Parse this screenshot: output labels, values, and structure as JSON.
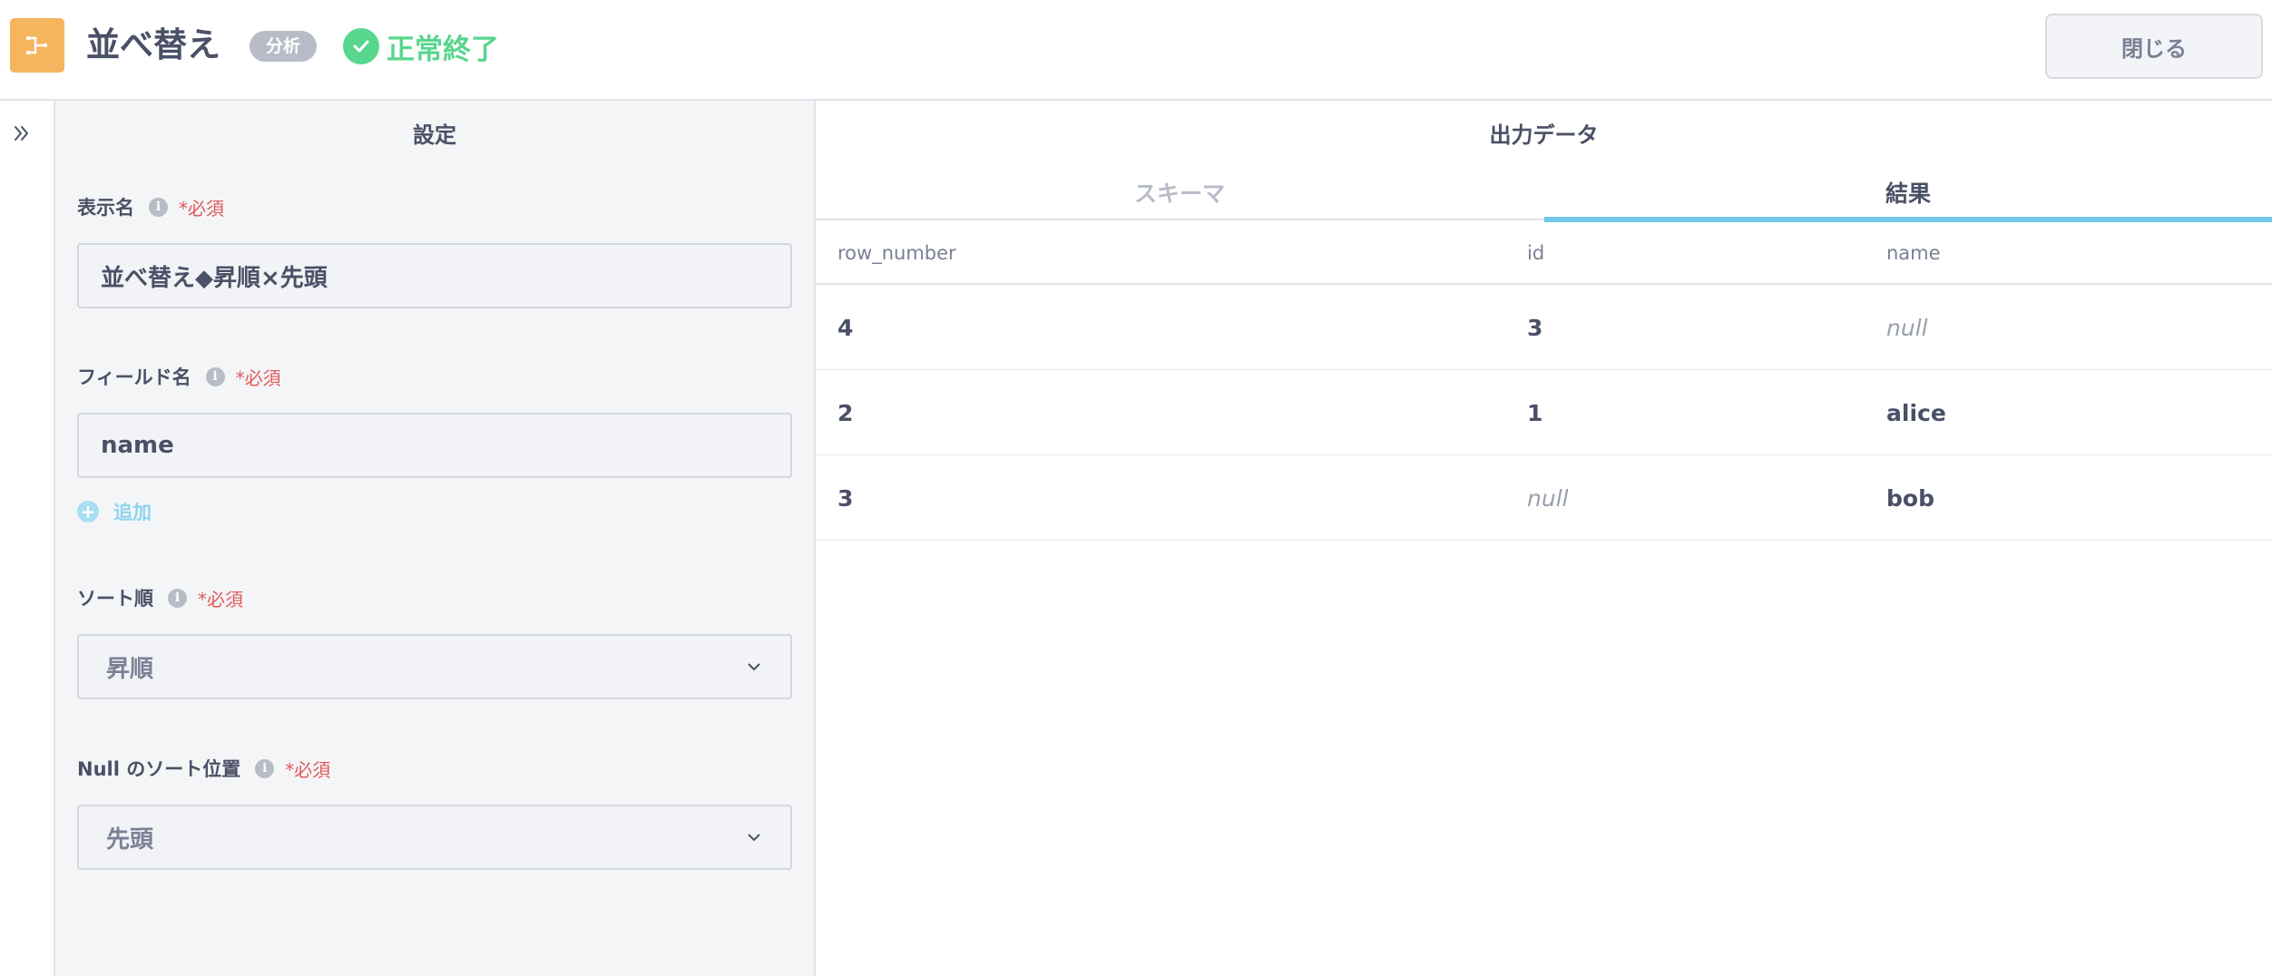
{
  "header": {
    "title": "並べ替え",
    "tag": "分析",
    "status": "正常終了",
    "close_label": "閉じる"
  },
  "settings": {
    "panel_title": "設定",
    "required_mark": "*必須",
    "display_name": {
      "label": "表示名",
      "value": "並べ替え◆昇順×先頭"
    },
    "field_name": {
      "label": "フィールド名",
      "value": "name"
    },
    "add_label": "追加",
    "sort_order": {
      "label": "ソート順",
      "value": "昇順"
    },
    "null_position": {
      "label": "Null のソート位置",
      "value": "先頭"
    }
  },
  "output": {
    "title": "出力データ",
    "tabs": {
      "schema": "スキーマ",
      "result": "結果"
    },
    "columns": [
      "row_number",
      "id",
      "name"
    ],
    "rows": [
      [
        "4",
        "3",
        "null"
      ],
      [
        "2",
        "1",
        "alice"
      ],
      [
        "3",
        "null",
        "bob"
      ]
    ]
  },
  "colors": {
    "accent": "#74c8ea",
    "success": "#58d68d",
    "app_icon": "#f5b55e",
    "required": "#e05a5a"
  }
}
